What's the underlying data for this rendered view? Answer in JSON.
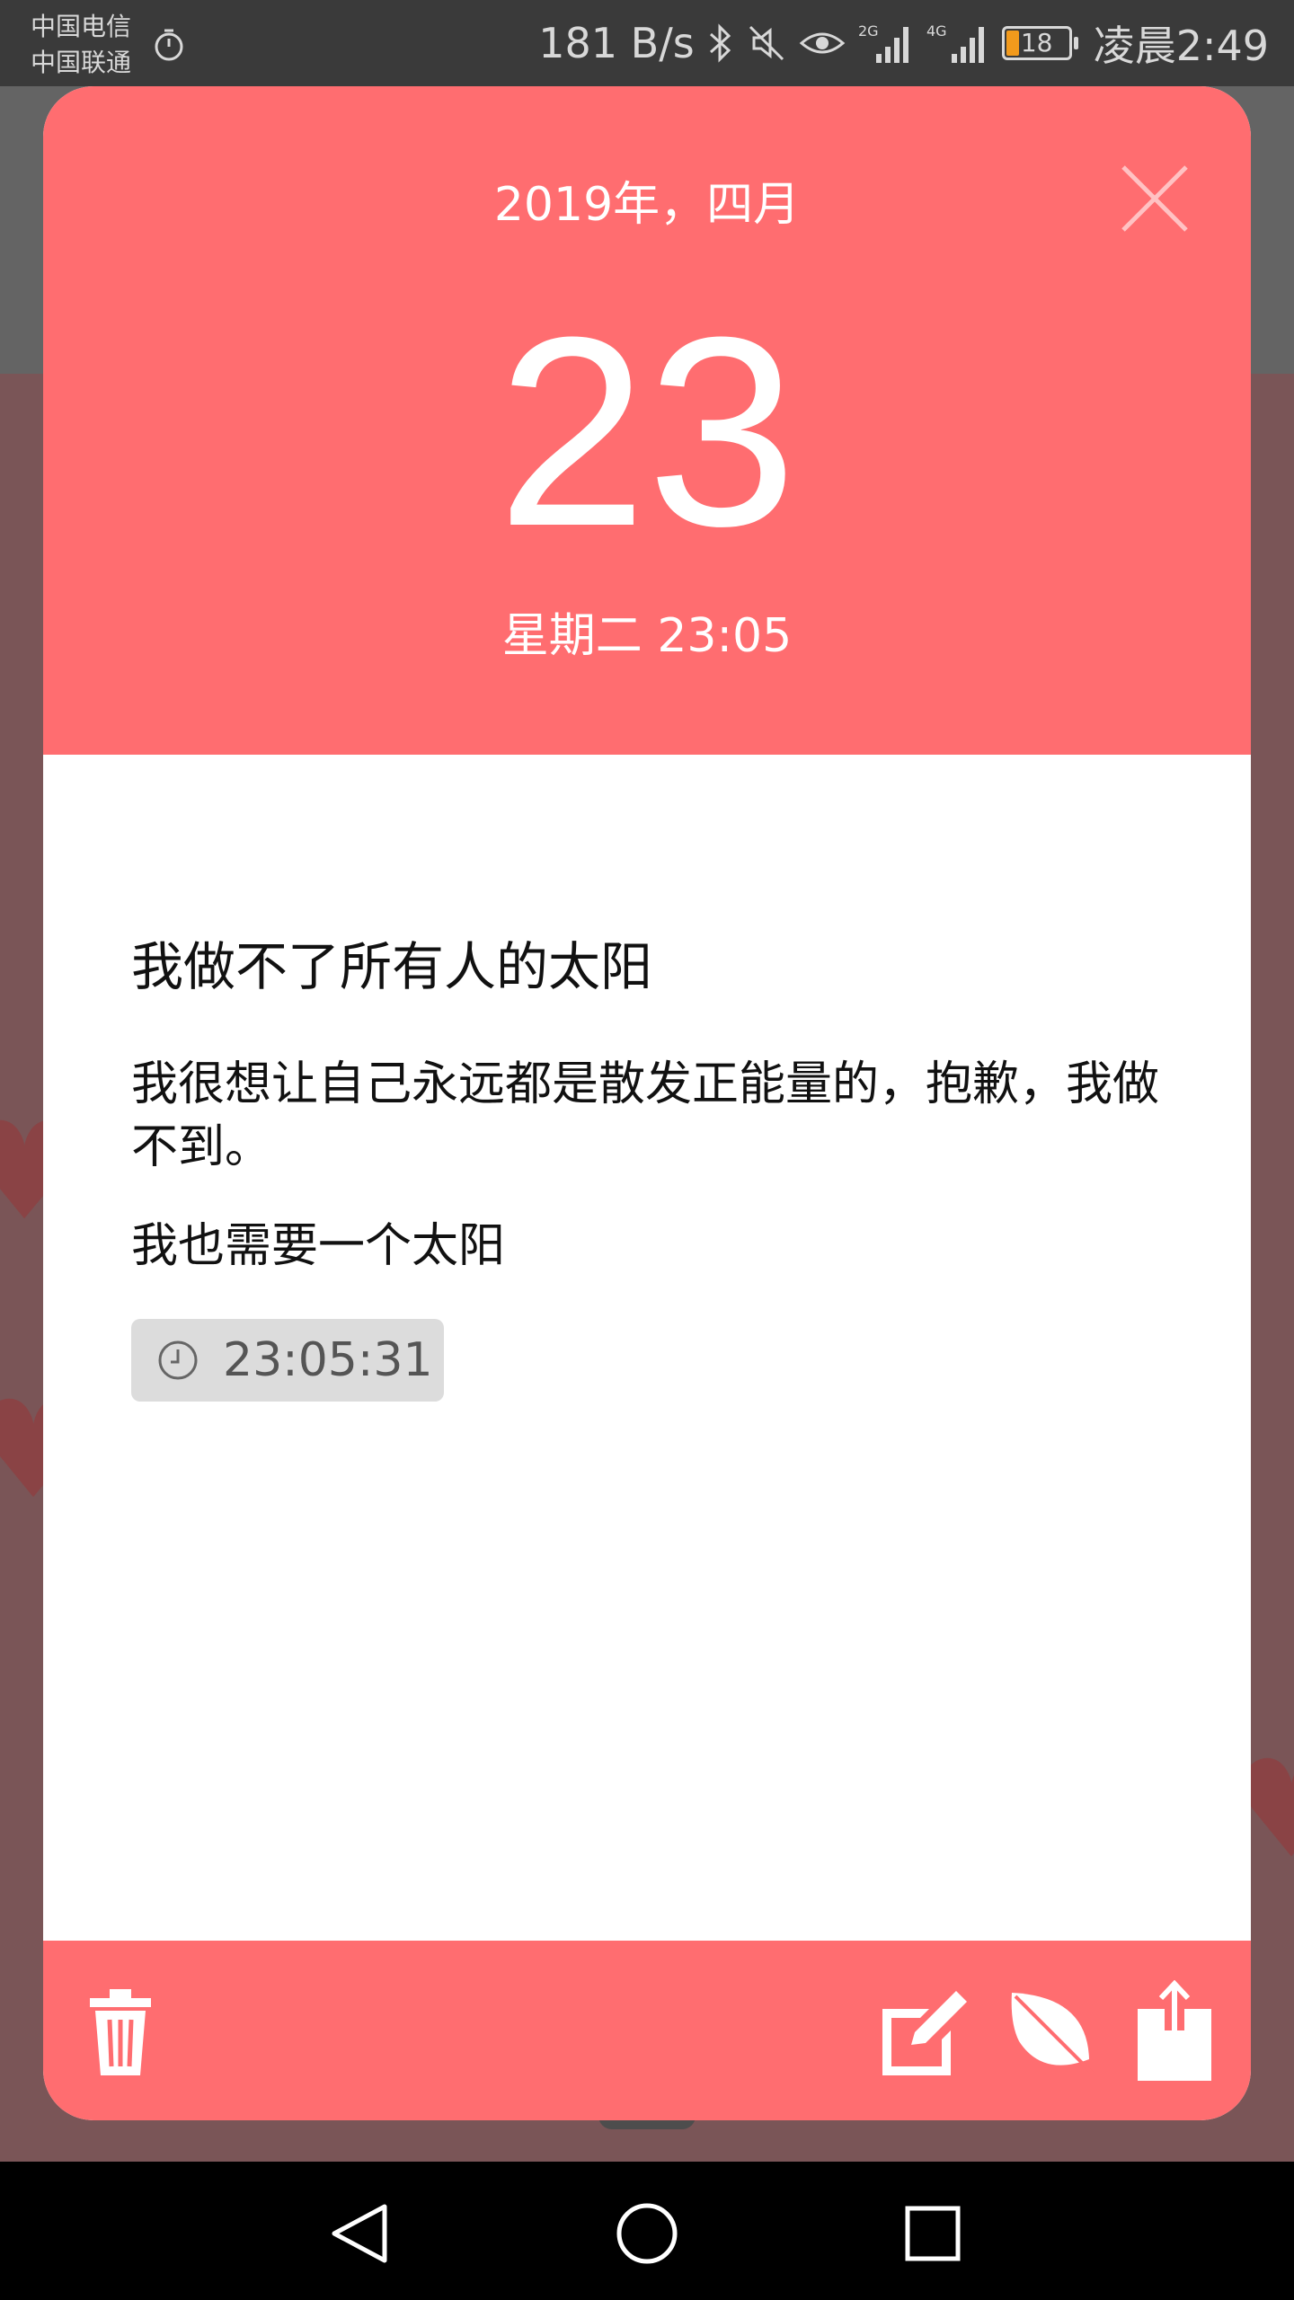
{
  "status_bar": {
    "carrier_1": "中国电信",
    "carrier_2": "中国联通",
    "network_speed": "181 B/s",
    "network_2g": "2G",
    "network_4g": "4G",
    "battery_level": "18",
    "time": "凌晨2:49",
    "icons": [
      "timer-icon",
      "bluetooth-icon",
      "mute-icon",
      "eye-icon",
      "signal-icon",
      "battery-icon"
    ]
  },
  "dialog": {
    "month_label": "2019年，四月",
    "day": "23",
    "weekday_time": "星期二 23:05",
    "note": {
      "title": "我做不了所有人的太阳",
      "body": "我很想让自己永远都是散发正能量的，抱歉，我做不到。",
      "line3": "我也需要一个太阳",
      "timestamp": "23:05:31"
    },
    "actions": [
      "trash-icon",
      "edit-icon",
      "leaf-icon",
      "share-icon"
    ]
  },
  "colors": {
    "accent": "#ff6d70",
    "status_bar": "#3a3a3a",
    "badge_bg": "#dcdcdc"
  },
  "navigation": [
    "back-icon",
    "home-icon",
    "recents-icon"
  ]
}
